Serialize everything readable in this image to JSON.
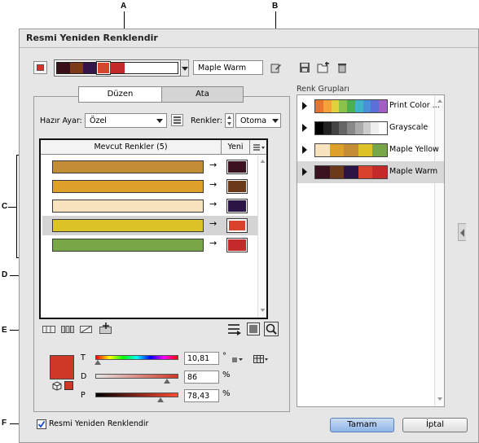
{
  "callouts": {
    "a": "A",
    "b": "B",
    "c": "C",
    "d": "D",
    "e": "E",
    "f": "F"
  },
  "window": {
    "title": "Resmi Yeniden Renklendir"
  },
  "toolbar": {
    "group_swatches": [
      "#3a1018",
      "#7a3c1a",
      "#33164a",
      "#d6462e",
      "#c22a2a"
    ],
    "group_name_value": "Maple Warm"
  },
  "tabs": [
    {
      "label": "Düzen"
    },
    {
      "label": "Ata"
    }
  ],
  "preset": {
    "label": "Hazır Ayar:",
    "value": "Özel"
  },
  "colors": {
    "label": "Renkler:",
    "value": "Otoma"
  },
  "table": {
    "header_current": "Mevcut Renkler (5)",
    "header_new": "Yeni",
    "rows": [
      {
        "current": "#c38d36",
        "new": "#3b1220"
      },
      {
        "current": "#dda02a",
        "new": "#6b3a1a"
      },
      {
        "current": "#f7e3bd",
        "new": "#2a1545"
      },
      {
        "current": "#dcc327",
        "new": "#d8432d"
      },
      {
        "current": "#79a646",
        "new": "#c32a2a"
      }
    ],
    "selected_row": 3
  },
  "color_editor": {
    "swatch": "#cf3727",
    "sliders": [
      {
        "label": "T",
        "value": "10,81",
        "unit": "°",
        "level": 0.03
      },
      {
        "label": "D",
        "value": "86",
        "unit": "%",
        "level": 0.86
      },
      {
        "label": "P",
        "value": "78,43",
        "unit": "%",
        "level": 0.78
      }
    ]
  },
  "groups_panel": {
    "title": "Renk Grupları",
    "groups": [
      {
        "name": "Print Color ...",
        "colors": [
          "#e8742e",
          "#f5a23a",
          "#e0d23a",
          "#8bc34a",
          "#4caf50",
          "#3fb5c8",
          "#4a90d9",
          "#5b6fd6",
          "#a260c4"
        ]
      },
      {
        "name": "Grayscale",
        "colors": [
          "#000000",
          "#222222",
          "#444444",
          "#666666",
          "#888888",
          "#aaaaaa",
          "#cccccc",
          "#eeeeee",
          "#ffffff"
        ]
      },
      {
        "name": "Maple Yellow",
        "colors": [
          "#f7e3bd",
          "#dda02a",
          "#c38d36",
          "#dcc327",
          "#79a646"
        ]
      },
      {
        "name": "Maple Warm",
        "colors": [
          "#3b1220",
          "#6b3a1a",
          "#2a1545",
          "#d8432d",
          "#c32a2a"
        ]
      }
    ],
    "selected": 3
  },
  "footer": {
    "recolor_checkbox_label": "Resmi Yeniden Renklendir",
    "recolor_checked": true,
    "ok_label": "Tamam",
    "cancel_label": "İptal"
  }
}
